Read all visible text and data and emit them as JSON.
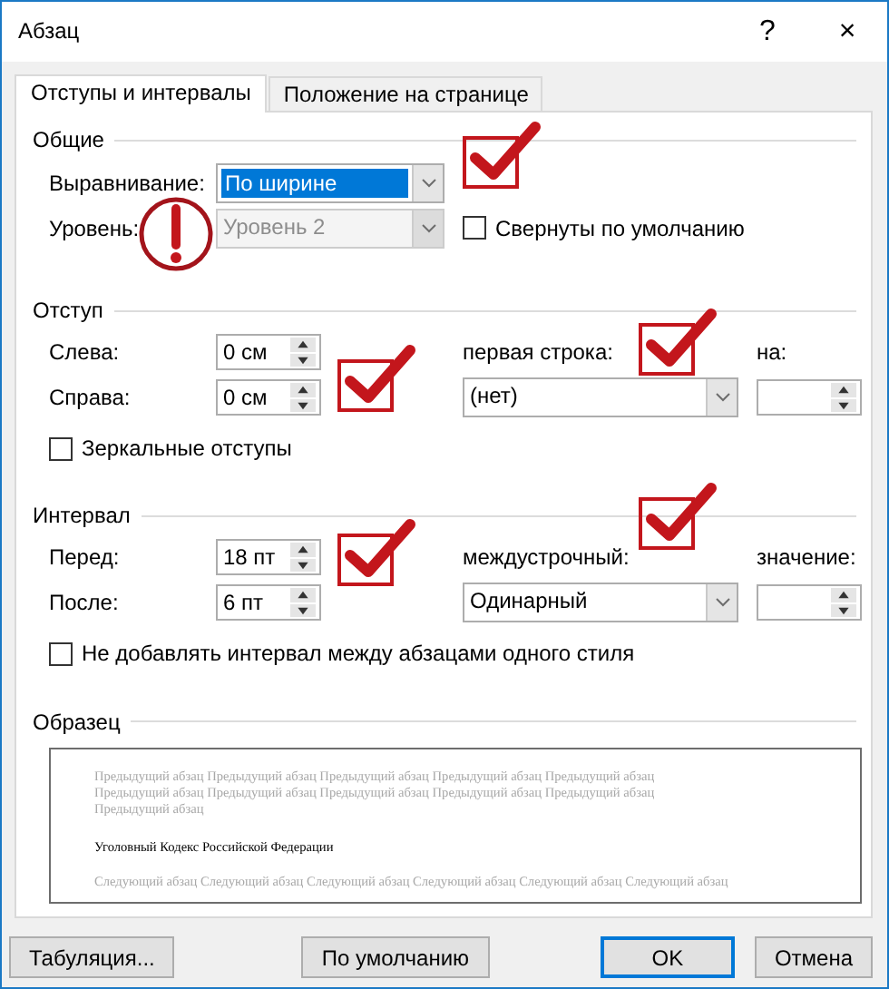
{
  "window": {
    "title": "Абзац",
    "help_button": "?",
    "close_button": "×"
  },
  "tabs": [
    {
      "label": "Отступы и интервалы",
      "selected": true
    },
    {
      "label": "Положение на странице",
      "selected": false
    }
  ],
  "general": {
    "title": "Общие",
    "alignment": {
      "label": "Выравнивание:",
      "value": "По ширине",
      "highlighted": true,
      "disabled": false,
      "mark": {
        "kind": "check"
      }
    },
    "level": {
      "label": "Уровень:",
      "value": "Уровень 2",
      "highlighted": false,
      "disabled": true,
      "mark": {
        "kind": "exclamation"
      }
    },
    "collapsed": {
      "label": "Свернуты по умолчанию",
      "checked": false
    }
  },
  "indent": {
    "title": "Отступ",
    "fields_mark": {
      "kind": "check"
    },
    "fields": [
      {
        "label": "Слева:",
        "value": "0 см"
      },
      {
        "label": "Справа:",
        "value": "0 см"
      }
    ],
    "special": {
      "label": "первая строка:",
      "value": "(нет)",
      "mark": {
        "kind": "check"
      }
    },
    "by": {
      "label": "на:"
    },
    "mirror": {
      "label": "Зеркальные отступы",
      "checked": false
    }
  },
  "spacing": {
    "title": "Интервал",
    "fields_mark": {
      "kind": "check"
    },
    "fields": [
      {
        "label": "Перед:",
        "value": "18 пт"
      },
      {
        "label": "После:",
        "value": "6 пт"
      }
    ],
    "special": {
      "label": "междустрочный:",
      "value": "Одинарный",
      "mark": {
        "kind": "check"
      }
    },
    "by": {
      "label": "значение:"
    },
    "no_space": {
      "label": "Не добавлять интервал между абзацами одного стиля",
      "checked": false
    }
  },
  "preview": {
    "title": "Образец",
    "previous_lines": [
      "Предыдущий абзац Предыдущий абзац Предыдущий абзац Предыдущий абзац Предыдущий абзац",
      "Предыдущий абзац Предыдущий абзац Предыдущий абзац Предыдущий абзац Предыдущий абзац",
      "Предыдущий абзац"
    ],
    "current": "Уголовный Кодекс Российской Федерации",
    "next_lines": [
      "Следующий абзац Следующий абзац Следующий абзац Следующий абзац Следующий абзац Следующий абзац"
    ]
  },
  "buttons": [
    {
      "label": "Табуляция...",
      "kind": "plain"
    },
    {
      "label": "По умолчанию",
      "kind": "plain"
    },
    {
      "label": "OK",
      "kind": "default"
    },
    {
      "label": "Отмена",
      "kind": "plain"
    }
  ]
}
